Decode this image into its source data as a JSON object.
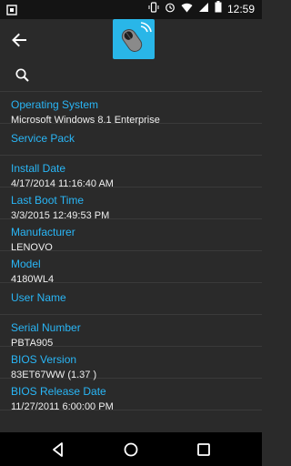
{
  "status_bar": {
    "time": "12:59",
    "icons": [
      "notification-icon",
      "vibrate-icon",
      "alarm-icon",
      "wifi-icon",
      "signal-icon",
      "battery-icon"
    ]
  },
  "app_bar": {
    "back_icon": "arrow-back-icon",
    "logo_icon": "mouse-app-icon"
  },
  "search": {
    "placeholder": ""
  },
  "items": [
    {
      "label": "Operating System",
      "value": "Microsoft Windows 8.1 Enterprise"
    },
    {
      "label": "Service Pack",
      "value": ""
    },
    {
      "label": "Install Date",
      "value": "4/17/2014 11:16:40 AM"
    },
    {
      "label": "Last Boot Time",
      "value": "3/3/2015 12:49:53 PM"
    },
    {
      "label": "Manufacturer",
      "value": "LENOVO"
    },
    {
      "label": "Model",
      "value": "4180WL4"
    },
    {
      "label": "User Name",
      "value": ""
    },
    {
      "label": "Serial Number",
      "value": "PBTA905"
    },
    {
      "label": "BIOS Version",
      "value": "83ET67WW (1.37 )"
    },
    {
      "label": "BIOS Release Date",
      "value": "11/27/2011 6:00:00 PM"
    }
  ],
  "nav": {
    "back_icon": "nav-back-icon",
    "home_icon": "nav-home-icon",
    "recents_icon": "nav-recents-icon"
  },
  "colors": {
    "accent": "#29b6f6",
    "background": "#2a2a2a",
    "logo": "#29b6e8"
  }
}
